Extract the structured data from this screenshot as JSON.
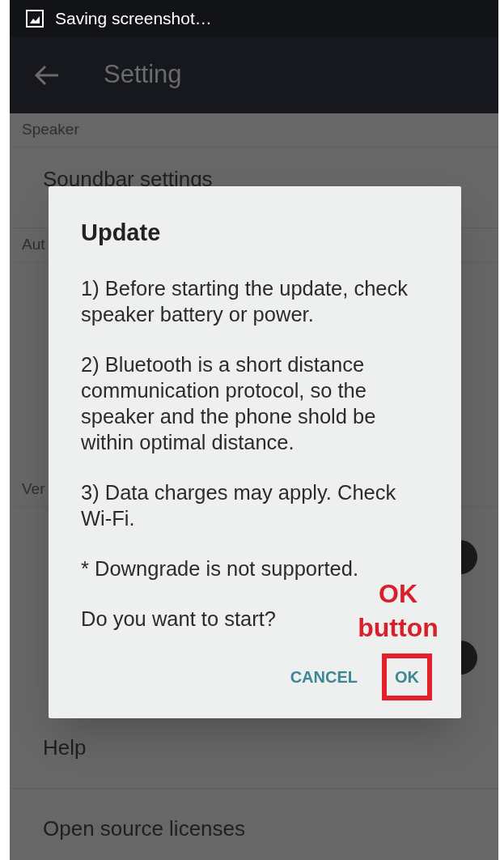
{
  "status_bar": {
    "notification": "Saving screenshot…"
  },
  "app_bar": {
    "title": "Setting"
  },
  "settings": [
    {
      "kind": "header",
      "label": "Speaker"
    },
    {
      "kind": "item",
      "label": "Soundbar settings"
    },
    {
      "kind": "header",
      "label": "Aut"
    },
    {
      "kind": "gap"
    },
    {
      "kind": "header",
      "label": "Ver"
    },
    {
      "kind": "switch"
    },
    {
      "kind": "switch"
    },
    {
      "kind": "item",
      "label": "Help"
    },
    {
      "kind": "item",
      "label": "Open source licenses"
    }
  ],
  "dialog": {
    "title": "Update",
    "paragraphs": [
      "1) Before starting the update, check speaker battery or power.",
      "2) Bluetooth is a short distance communication protocol, so the speaker and the phone shold be within optimal distance.",
      "3) Data charges may apply. Check Wi-Fi.",
      "* Downgrade is not supported.",
      "Do you want to start?"
    ],
    "buttons": [
      {
        "label": "CANCEL",
        "highlighted": false
      },
      {
        "label": "OK",
        "highlighted": true
      }
    ]
  },
  "annotation": {
    "label": "OK button"
  }
}
